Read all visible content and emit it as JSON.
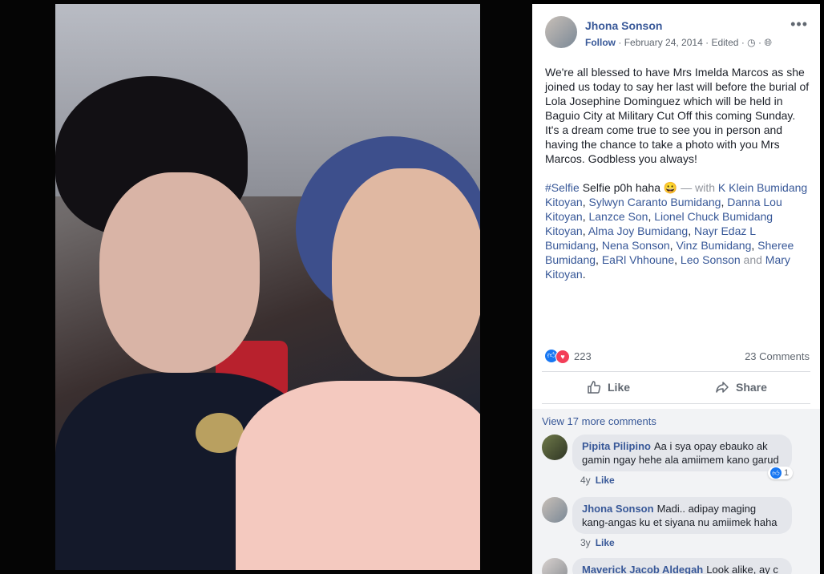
{
  "post": {
    "author": "Jhona Sonson",
    "follow": "Follow",
    "date": "February 24, 2014",
    "edited": "Edited",
    "text": "We're all blessed to have Mrs Imelda Marcos as she joined us today to say her last will before the burial of Lola Josephine Dominguez which will be held in Baguio City at Military Cut Off this coming Sunday. It's a dream come true to see you in person and having the chance to take a photo with you Mrs Marcos. Godbless you always!",
    "hashtag": "#Selfie",
    "after_hashtag": "Selfie p0h haha 😀",
    "with_label": "— with",
    "tagged": [
      "K Klein Bumidang Kitoyan",
      "Sylwyn Caranto Bumidang",
      "Danna Lou Kitoyan",
      "Lanzce Son",
      "Lionel Chuck Bumidang Kitoyan",
      "Alma Joy Bumidang",
      "Nayr Edaz L Bumidang",
      "Nena Sonson",
      "Vinz Bumidang",
      "Sheree Bumidang",
      "EaRl Vhhoune",
      "Leo Sonson",
      "Mary Kitoyan"
    ],
    "and_label": "and",
    "reaction_count": "223",
    "comment_count": "23 Comments"
  },
  "actions": {
    "like": "Like",
    "share": "Share"
  },
  "comments": {
    "view_more": "View 17 more comments",
    "items": [
      {
        "name": "Pipita Pilipino",
        "text": "Aa i sya opay ebauko ak gamin ngay hehe ala amiimem kano garud",
        "time": "4y",
        "like": "Like",
        "reactions": "1"
      },
      {
        "name": "Jhona Sonson",
        "text": "Madi.. adipay maging kang-angas ku et siyana nu amiimek haha",
        "time": "3y",
        "like": "Like"
      },
      {
        "name": "Maverick Jacob Aldegah",
        "text": "Look alike, ay c"
      }
    ]
  },
  "icons": [
    "more-icon",
    "clock-icon",
    "globe-icon",
    "like-reaction-icon",
    "love-reaction-icon",
    "thumbs-up-icon",
    "share-icon"
  ],
  "colors": {
    "link": "#385898",
    "like_blue": "#1877f2",
    "love_red": "#f33e58"
  }
}
